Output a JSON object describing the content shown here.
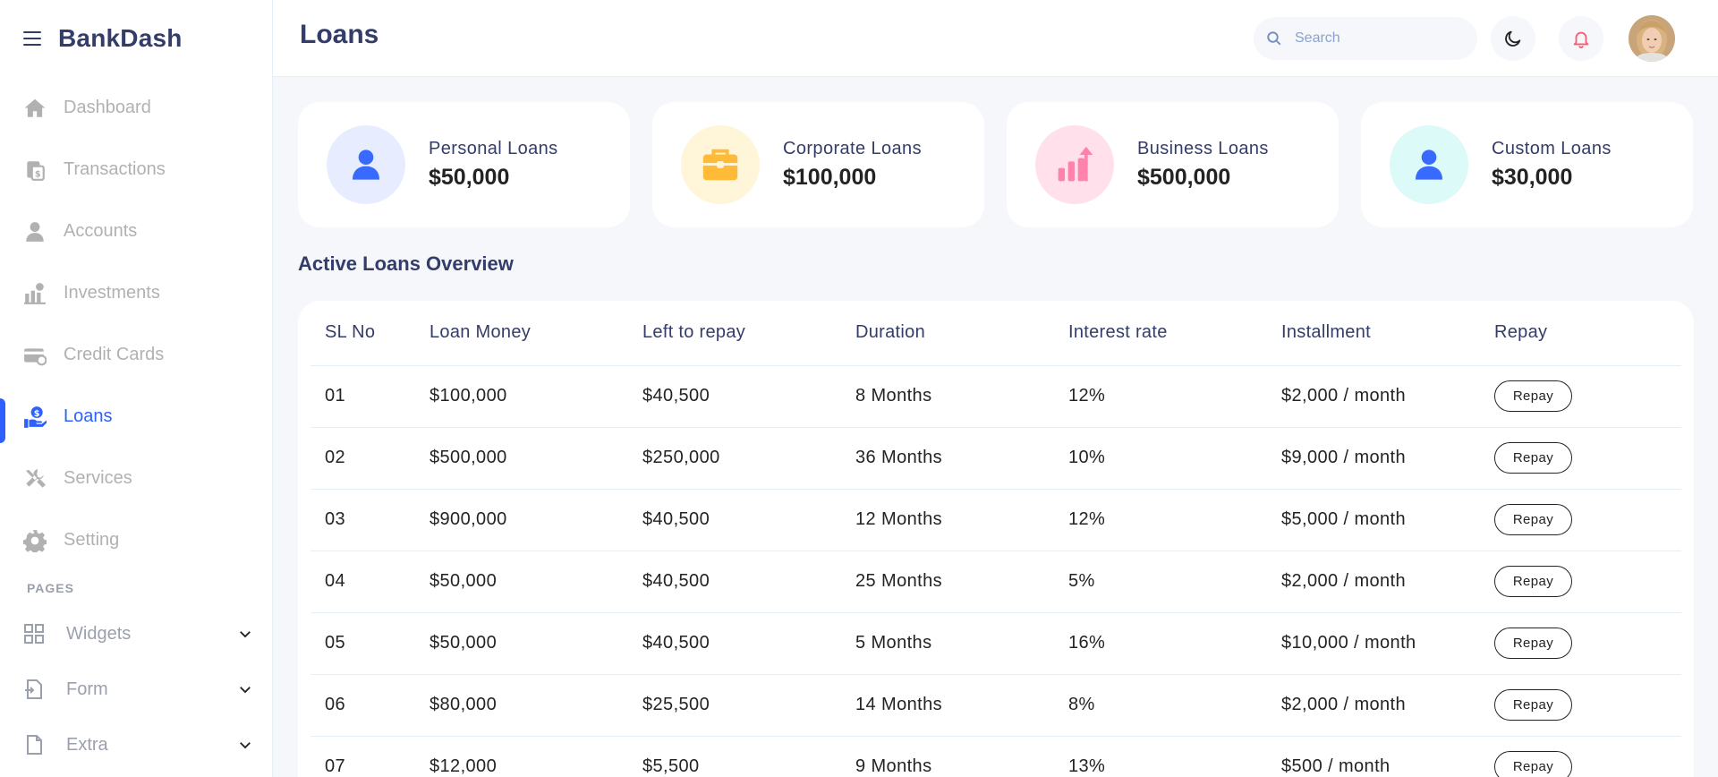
{
  "app": {
    "brand": "BankDash"
  },
  "header": {
    "title": "Loans",
    "search_placeholder": "Search"
  },
  "sidebar": {
    "items": [
      {
        "label": "Dashboard",
        "icon": "home-icon"
      },
      {
        "label": "Transactions",
        "icon": "transfer-icon"
      },
      {
        "label": "Accounts",
        "icon": "user-icon"
      },
      {
        "label": "Investments",
        "icon": "investment-icon"
      },
      {
        "label": "Credit Cards",
        "icon": "credit-card-icon"
      },
      {
        "label": "Loans",
        "icon": "loan-icon",
        "active": true
      },
      {
        "label": "Services",
        "icon": "services-icon"
      },
      {
        "label": "Setting",
        "icon": "gear-icon"
      }
    ],
    "pages_title": "PAGES",
    "pages": [
      {
        "label": "Widgets",
        "icon": "grid-icon"
      },
      {
        "label": "Form",
        "icon": "file-plus-icon"
      },
      {
        "label": "Extra",
        "icon": "file-icon"
      }
    ]
  },
  "cards": [
    {
      "title": "Personal Loans",
      "value": "$50,000",
      "icon": "user-icon",
      "bg": "#e7edff",
      "fg": "#396aff"
    },
    {
      "title": "Corporate Loans",
      "value": "$100,000",
      "icon": "briefcase-icon",
      "bg": "#fff5d9",
      "fg": "#ffbb38"
    },
    {
      "title": "Business Loans",
      "value": "$500,000",
      "icon": "chart-up-icon",
      "bg": "#ffe0eb",
      "fg": "#ff82ac"
    },
    {
      "title": "Custom Loans",
      "value": "$30,000",
      "icon": "user-icon",
      "bg": "#dcfaf8",
      "fg": "#396aff"
    }
  ],
  "section_title": "Active Loans Overview",
  "table": {
    "headers": [
      "SL No",
      "Loan Money",
      "Left to repay",
      "Duration",
      "Interest rate",
      "Installment",
      "Repay"
    ],
    "rows": [
      [
        "01",
        "$100,000",
        "$40,500",
        "8 Months",
        "12%",
        "$2,000 / month"
      ],
      [
        "02",
        "$500,000",
        "$250,000",
        "36 Months",
        "10%",
        "$9,000 / month"
      ],
      [
        "03",
        "$900,000",
        "$40,500",
        "12 Months",
        "12%",
        "$5,000 / month"
      ],
      [
        "04",
        "$50,000",
        "$40,500",
        "25 Months",
        "5%",
        "$2,000 / month"
      ],
      [
        "05",
        "$50,000",
        "$40,500",
        "5 Months",
        "16%",
        "$10,000 / month"
      ],
      [
        "06",
        "$80,000",
        "$25,500",
        "14 Months",
        "8%",
        "$2,000 / month"
      ],
      [
        "07",
        "$12,000",
        "$5,500",
        "9 Months",
        "13%",
        "$500 / month"
      ]
    ],
    "repay_label": "Repay"
  },
  "colors": {
    "accent": "#2d60ff",
    "title": "#343c6a",
    "muted": "#b1b1b1",
    "bell": "#fe5c73"
  }
}
